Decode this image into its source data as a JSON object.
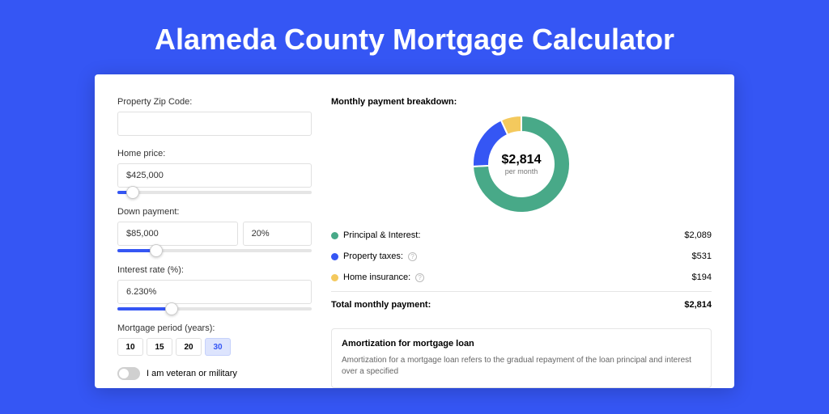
{
  "title": "Alameda County Mortgage Calculator",
  "form": {
    "zip_label": "Property Zip Code:",
    "zip_value": "",
    "price_label": "Home price:",
    "price_value": "$425,000",
    "price_slider_pct": 8,
    "down_label": "Down payment:",
    "down_value": "$85,000",
    "down_pct": "20%",
    "down_slider_pct": 20,
    "rate_label": "Interest rate (%):",
    "rate_value": "6.230%",
    "rate_slider_pct": 28,
    "period_label": "Mortgage period (years):",
    "periods": [
      "10",
      "15",
      "20",
      "30"
    ],
    "period_active_index": 3,
    "veteran_label": "I am veteran or military"
  },
  "results": {
    "breakdown_title": "Monthly payment breakdown:",
    "total": "$2,814",
    "per_month": "per month",
    "items": [
      {
        "label": "Principal & Interest:",
        "value": "$2,089",
        "raw": 2089,
        "color": "#48a988",
        "info": false
      },
      {
        "label": "Property taxes:",
        "value": "$531",
        "raw": 531,
        "color": "#3556f4",
        "info": true
      },
      {
        "label": "Home insurance:",
        "value": "$194",
        "raw": 194,
        "color": "#f4c95d",
        "info": true
      }
    ],
    "total_label": "Total monthly payment:",
    "total_value": "$2,814"
  },
  "chart_data": {
    "type": "pie",
    "title": "Monthly payment breakdown",
    "series": [
      {
        "name": "Principal & Interest",
        "value": 2089,
        "color": "#48a988"
      },
      {
        "name": "Property taxes",
        "value": 531,
        "color": "#3556f4"
      },
      {
        "name": "Home insurance",
        "value": 194,
        "color": "#f4c95d"
      }
    ],
    "center_label": "$2,814",
    "center_sub": "per month"
  },
  "amort": {
    "title": "Amortization for mortgage loan",
    "text": "Amortization for a mortgage loan refers to the gradual repayment of the loan principal and interest over a specified"
  }
}
